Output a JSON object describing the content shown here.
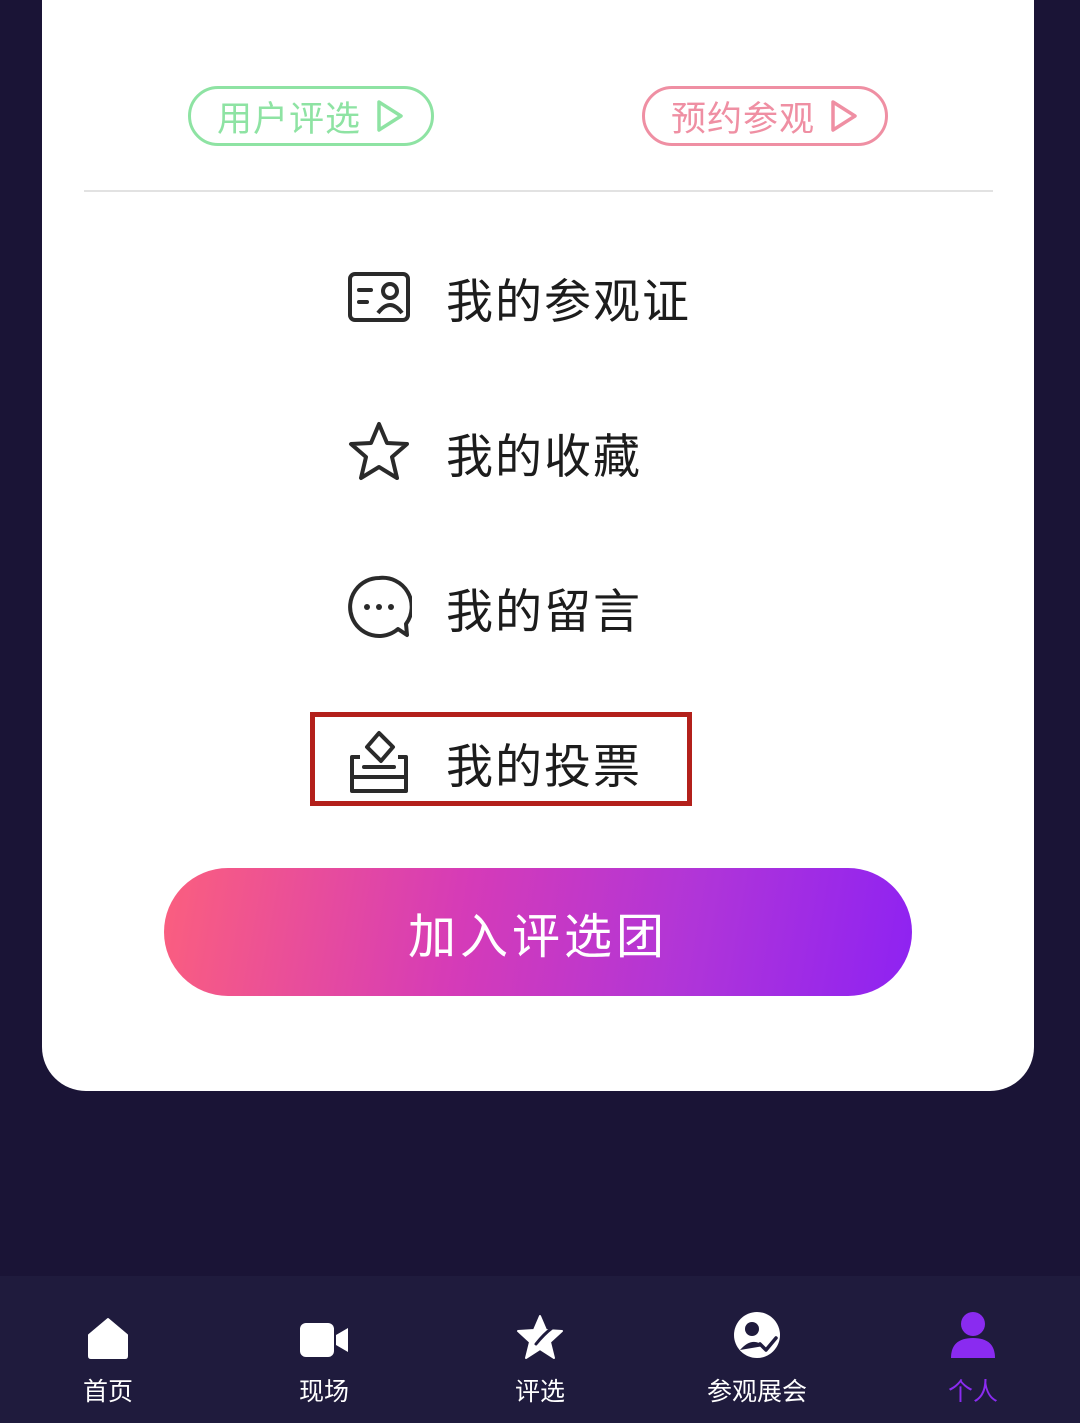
{
  "actions": {
    "user_vote_label": "用户评选",
    "book_visit_label": "预约参观"
  },
  "menu": {
    "items": [
      {
        "label": "我的参观证",
        "icon": "id-card-icon"
      },
      {
        "label": "我的收藏",
        "icon": "star-icon"
      },
      {
        "label": "我的留言",
        "icon": "chat-bubble-icon"
      },
      {
        "label": "我的投票",
        "icon": "ballot-box-icon"
      }
    ]
  },
  "join_button": {
    "label": "加入评选团"
  },
  "tabbar": {
    "tabs": [
      {
        "label": "首页",
        "icon": "home-icon"
      },
      {
        "label": "现场",
        "icon": "video-camera-icon"
      },
      {
        "label": "评选",
        "icon": "vote-star-icon"
      },
      {
        "label": "参观展会",
        "icon": "visit-check-icon"
      },
      {
        "label": "个人",
        "icon": "person-icon",
        "active": true
      }
    ]
  },
  "colors": {
    "background": "#1a1436",
    "green_accent": "#8ee3a3",
    "pink_accent": "#ef8fa3",
    "highlight_border": "#b3201b",
    "active_tab": "#8a2bf0",
    "gradient_start": "#fb5f7e",
    "gradient_end": "#8e22f2"
  }
}
